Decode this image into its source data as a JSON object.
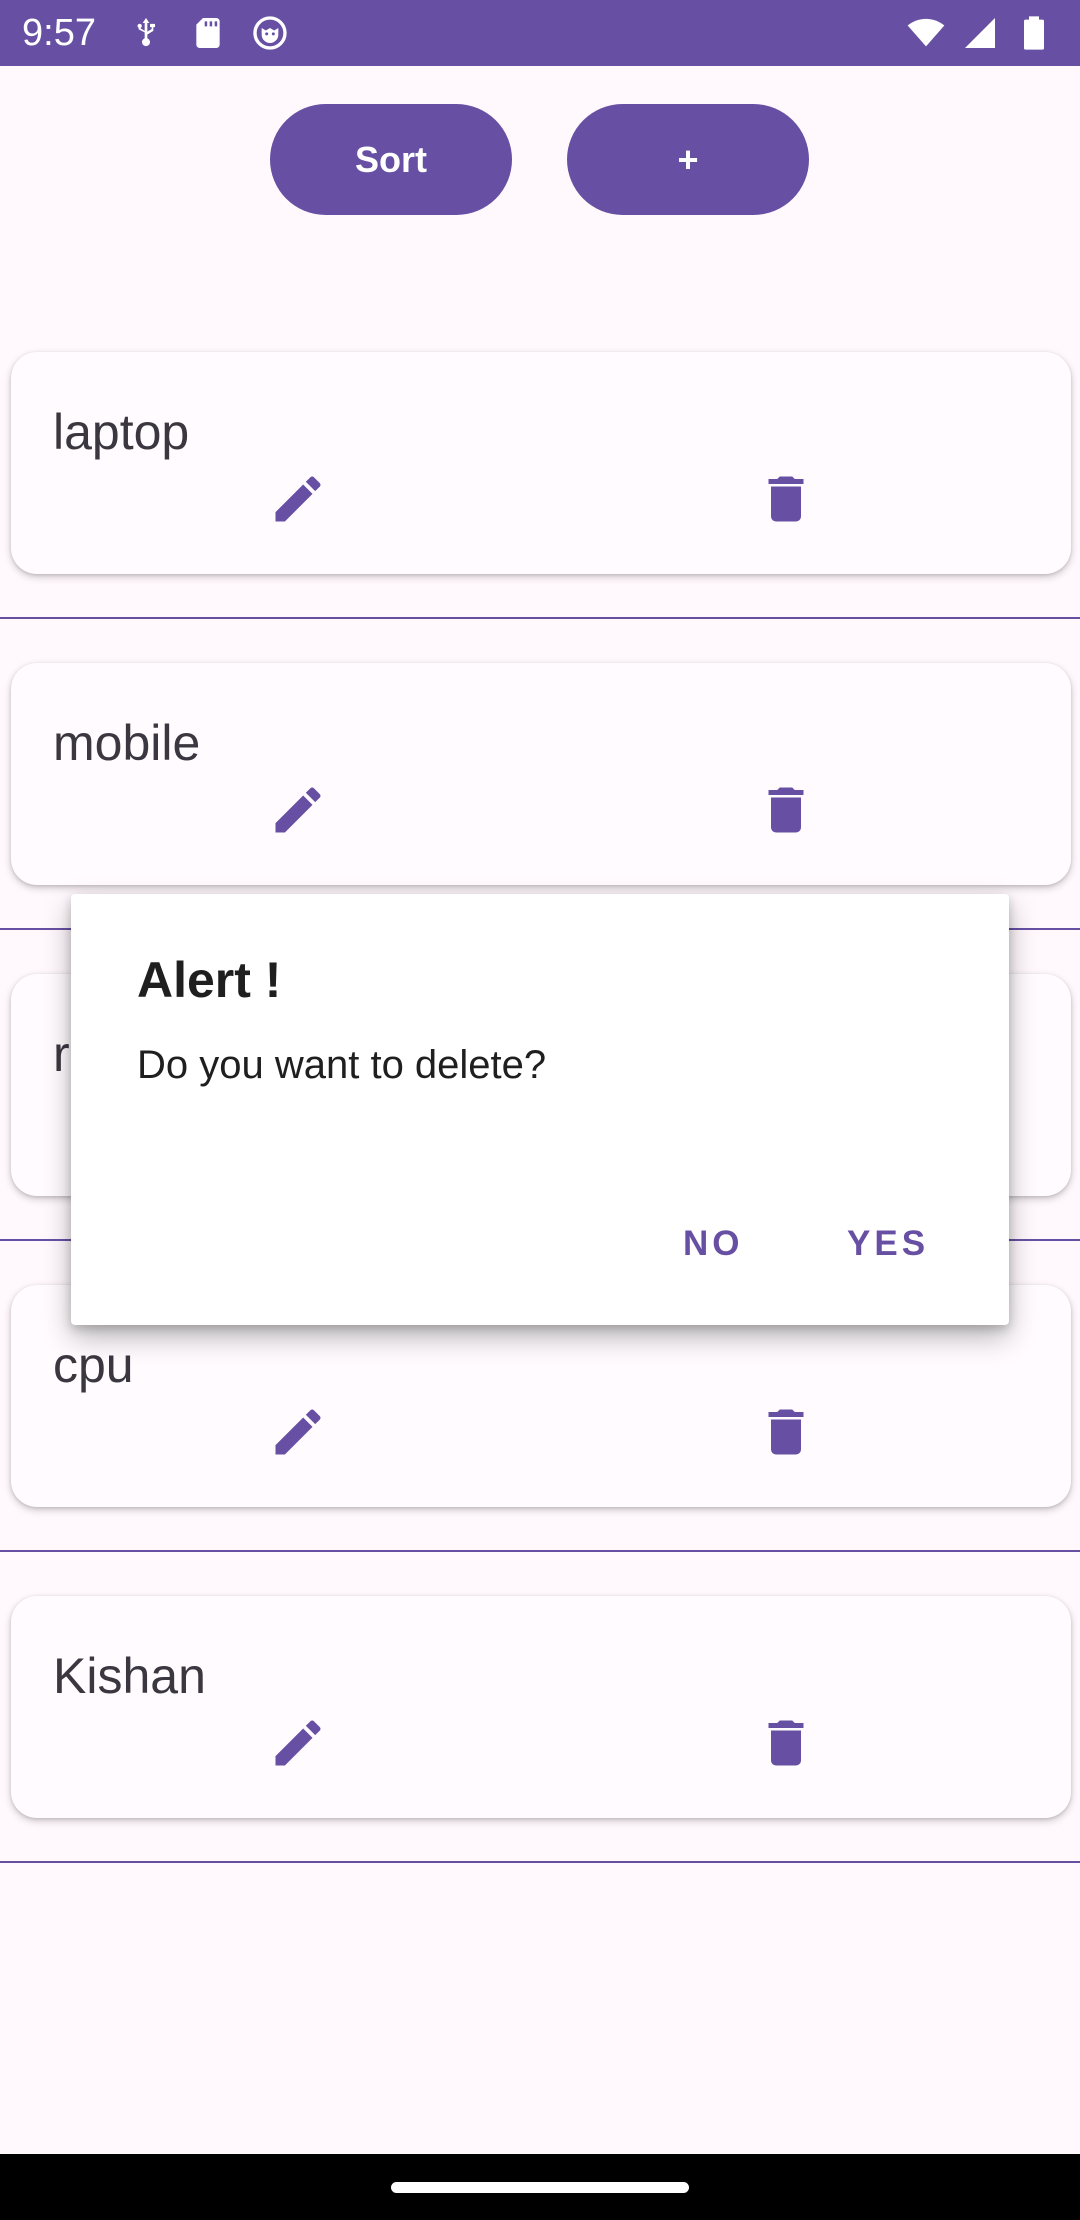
{
  "status_bar": {
    "time": "9:57",
    "color": "#6750A4",
    "left_icons": [
      "usb-debug-icon",
      "sd-card-icon",
      "cat-notification-icon"
    ],
    "right_icons": [
      "wifi-icon",
      "cellular-signal-icon",
      "battery-icon"
    ]
  },
  "toolbar": {
    "sort_label": "Sort",
    "add_label": "+"
  },
  "items": [
    {
      "name": "laptop"
    },
    {
      "name": "mobile"
    },
    {
      "name": "r"
    },
    {
      "name": "cpu"
    },
    {
      "name": "Kishan"
    }
  ],
  "dialog": {
    "title": "Alert !",
    "message": "Do you want to delete?",
    "no_label": "NO",
    "yes_label": "YES"
  },
  "colors": {
    "primary": "#6750A4",
    "background": "#FFF8FC",
    "card": "#FFFBFE"
  }
}
